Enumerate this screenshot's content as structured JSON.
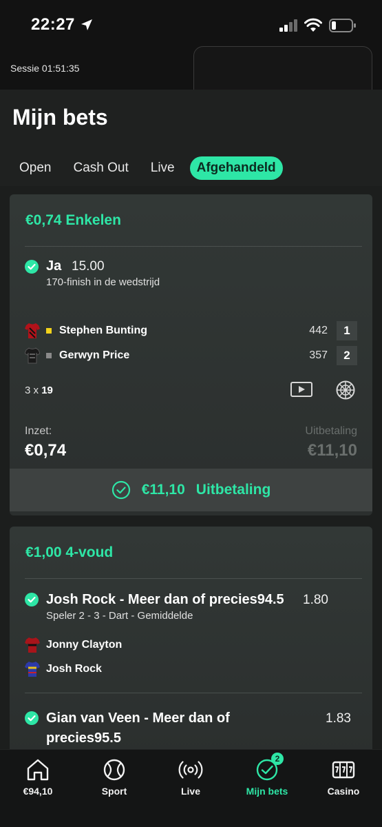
{
  "status_bar": {
    "time": "22:27"
  },
  "session": {
    "label": "Sessie 01:51:35"
  },
  "page": {
    "title": "Mijn bets"
  },
  "tabs": [
    {
      "label": "Open"
    },
    {
      "label": "Cash Out"
    },
    {
      "label": "Live"
    },
    {
      "label": "Afgehandeld",
      "active": true
    }
  ],
  "bet1": {
    "title": "€0,74 Enkelen",
    "selection": {
      "name": "Ja",
      "odds": "15.00",
      "market": "170-finish in de wedstrijd"
    },
    "players": [
      {
        "name": "Stephen Bunting",
        "score": "442",
        "legs": "1",
        "marker_color": "#f2d21b"
      },
      {
        "name": "Gerwyn Price",
        "score": "357",
        "legs": "2",
        "marker_color": "#8a8a8a"
      }
    ],
    "format_prefix": "3 x ",
    "format_value": "19",
    "stake_label": "Inzet:",
    "stake_value": "€0,74",
    "payout_label": "Uitbetaling",
    "payout_value": "€11,10",
    "result_amount": "€11,10",
    "result_label": "Uitbetaling"
  },
  "bet2": {
    "title": "€1,00 4-voud",
    "selections": [
      {
        "name": "Josh Rock - Meer dan of precies94.5",
        "odds": "1.80",
        "market": "Speler 2 - 3 - Dart - Gemiddelde"
      },
      {
        "name_line1": "Gian van Veen - Meer dan of",
        "name_line2": "precies95.5",
        "odds": "1.83"
      }
    ],
    "players": [
      {
        "name": "Jonny Clayton"
      },
      {
        "name": "Josh Rock"
      }
    ]
  },
  "bottom_nav": [
    {
      "label": "€94,10",
      "icon": "home-icon"
    },
    {
      "label": "Sport",
      "icon": "ball-icon"
    },
    {
      "label": "Live",
      "icon": "live-icon"
    },
    {
      "label": "Mijn bets",
      "icon": "check-circle-icon",
      "badge": "2",
      "active": true
    },
    {
      "label": "Casino",
      "icon": "slot-machine-icon"
    }
  ],
  "colors": {
    "accent": "#2ee6a6",
    "card": "#2c302f",
    "background": "#1c1e1d"
  }
}
